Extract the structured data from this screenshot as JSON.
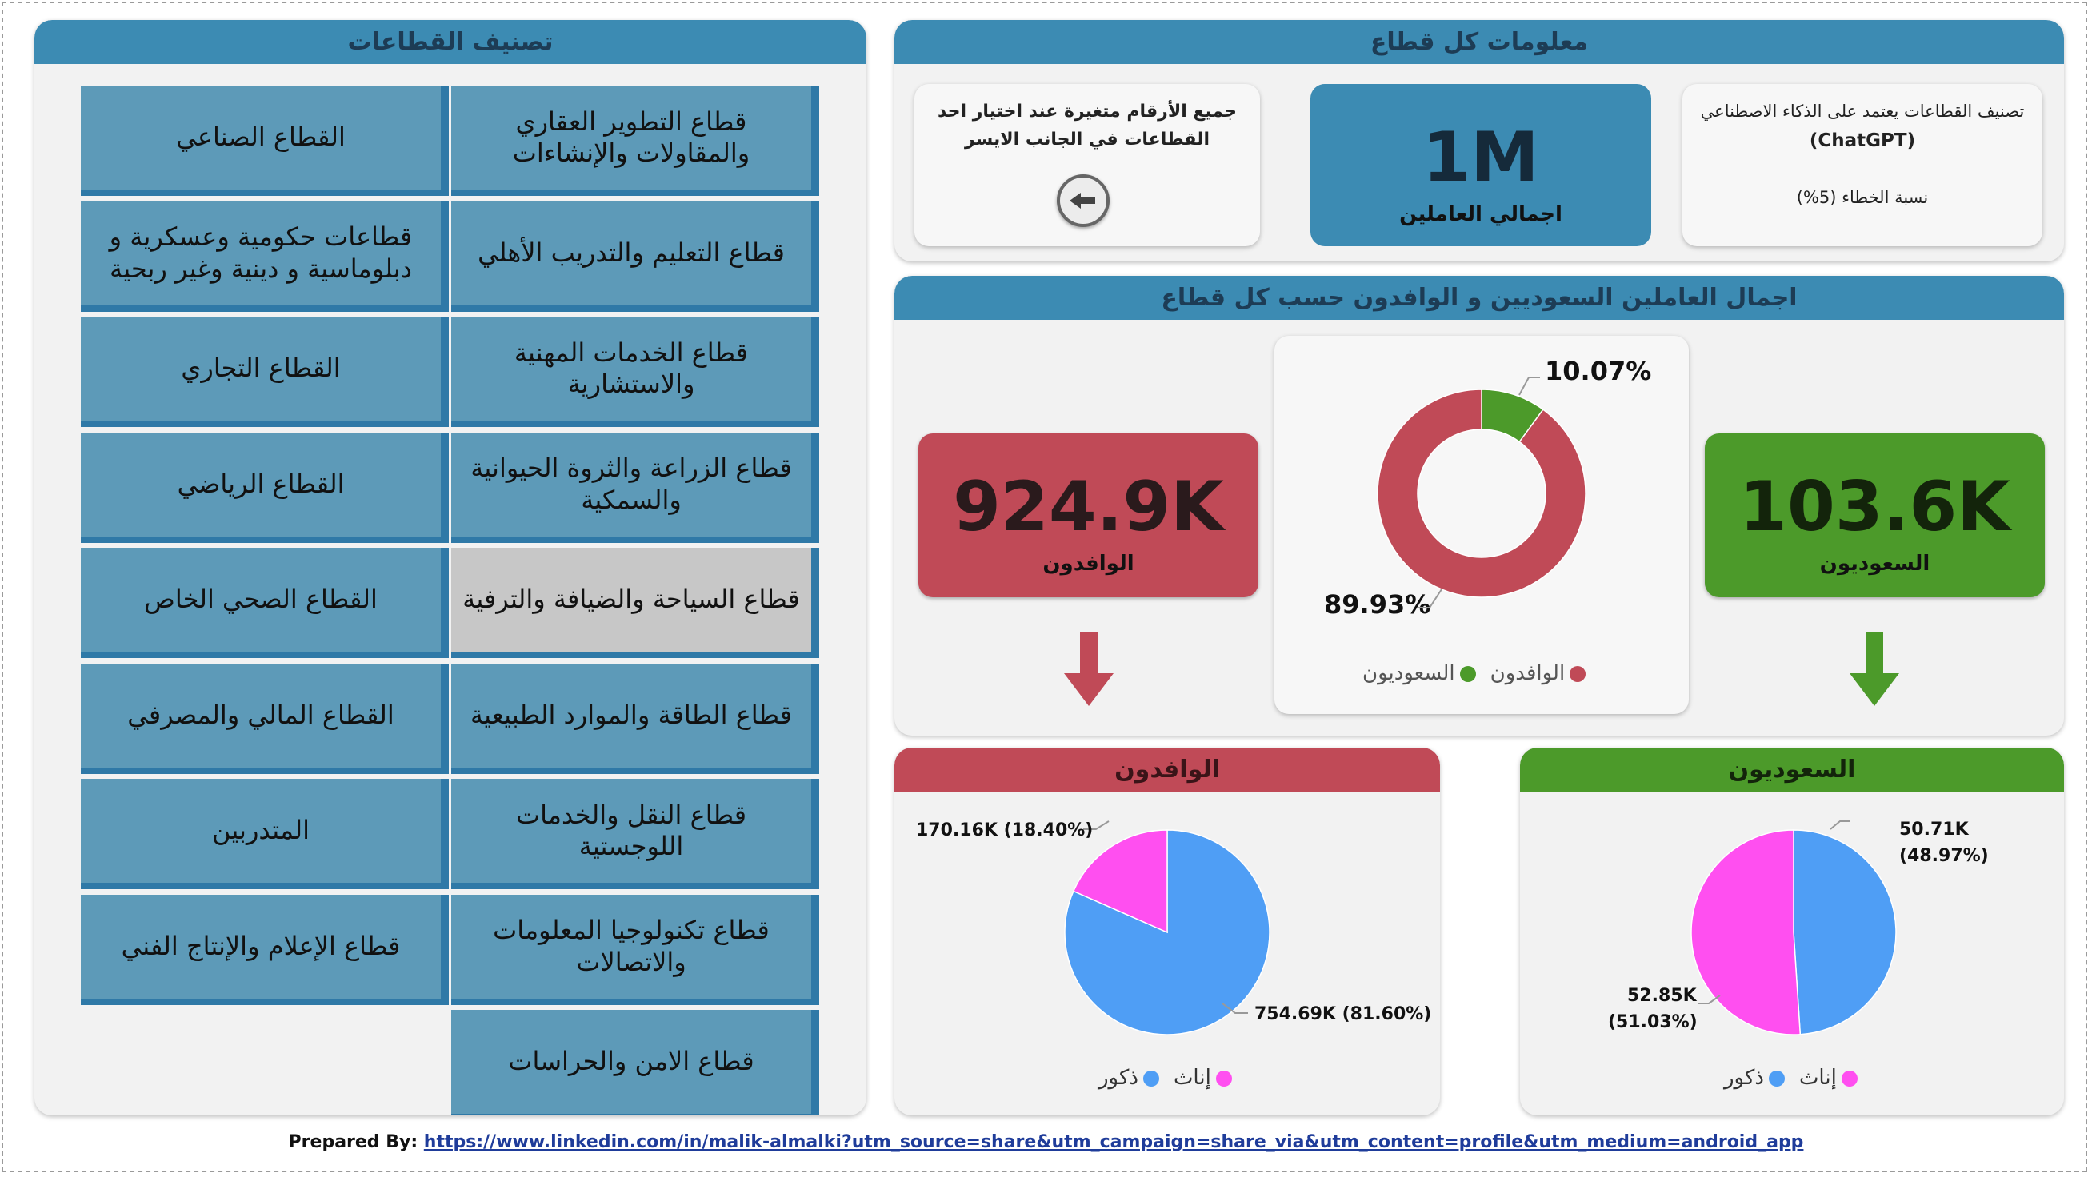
{
  "left_panel": {
    "title": "تصنيف القطاعات",
    "sectors": [
      "قطاع التطوير العقاري والمقاولات والإنشاءات",
      "القطاع الصناعي",
      "قطاع التعليم والتدريب الأهلي",
      "قطاعات حكومية وعسكرية و دبلوماسية و دينية وغير ربحية",
      "قطاع الخدمات المهنية والاستشارية",
      "القطاع التجاري",
      "قطاع الزراعة والثروة الحيوانية والسمكية",
      "القطاع الرياضي",
      "قطاع السياحة والضيافة والترفية",
      "القطاع الصحي الخاص",
      "قطاع الطاقة والموارد الطبيعية",
      "القطاع المالي والمصرفي",
      "قطاع النقل والخدمات اللوجستية",
      "المتدربين",
      "قطاع تكنولوجيا المعلومات والاتصالات",
      "قطاع الإعلام والإنتاج الفني",
      "قطاع الامن والحراسات"
    ],
    "selected_index": 8
  },
  "info_panel": {
    "title": "معلومات كل قطاع",
    "note_line1": "جميع الأرقام متغيرة عند اختيار احد",
    "note_line2": "القطاعات في الجانب الايسر",
    "back_icon": "arrow-left-icon",
    "total_value": "1M",
    "total_label": "اجمالي العاملين",
    "ai_line1": "تصنيف القطاعات يعتمد على الذكاء الاصطناعي",
    "ai_line2": "(ChatGPT)",
    "ai_line3": "نسبة الخطاء (5%)"
  },
  "workers_panel": {
    "title": "اجمال العاملين السعوديين و الوافدون حسب كل قطاع",
    "expat_value": "924.9K",
    "expat_label": "الوافدون",
    "saudi_value": "103.6K",
    "saudi_label": "السعوديون",
    "donut_label_saudi": "10.07%",
    "donut_label_expat": "89.93%",
    "legend_expat": "الوافدون",
    "legend_saudi": "السعوديون"
  },
  "expat_panel": {
    "title": "الوافدون",
    "label_female": "170.16K (18.40%)",
    "label_male": "754.69K (81.60%)",
    "legend_male": "ذكور",
    "legend_female": "إناث"
  },
  "saudi_panel": {
    "title": "السعوديون",
    "label_male_1": "50.71K",
    "label_male_2": "(48.97%)",
    "label_female_1": "52.85K",
    "label_female_2": "(51.03%)",
    "legend_male": "ذكور",
    "legend_female": "إناث"
  },
  "footer": {
    "prefix": "Prepared By:",
    "link": "https://www.linkedin.com/in/malik-almalki?utm_source=share&utm_campaign=share_via&utm_content=profile&utm_medium=android_app"
  },
  "colors": {
    "header_blue": "#3c8bb3",
    "saudi_green": "#4c9a2a",
    "expat_red": "#c04a57",
    "male_blue": "#4f9ef5",
    "female_pink": "#ff4ff0"
  },
  "chart_data": [
    {
      "type": "pie",
      "variant": "donut",
      "categories": [
        "الوافدون",
        "السعوديون"
      ],
      "values": [
        89.93,
        10.07
      ],
      "colors": [
        "#c04a57",
        "#4c9a2a"
      ],
      "legend": "bottom"
    },
    {
      "type": "pie",
      "title": "الوافدون",
      "categories": [
        "ذكور",
        "إناث"
      ],
      "values": [
        754.69,
        170.16
      ],
      "percent": [
        81.6,
        18.4
      ],
      "colors": [
        "#4f9ef5",
        "#ff4ff0"
      ],
      "legend": "bottom"
    },
    {
      "type": "pie",
      "title": "السعوديون",
      "categories": [
        "ذكور",
        "إناث"
      ],
      "values": [
        50.71,
        52.85
      ],
      "percent": [
        48.97,
        51.03
      ],
      "colors": [
        "#4f9ef5",
        "#ff4ff0"
      ],
      "legend": "bottom"
    }
  ]
}
